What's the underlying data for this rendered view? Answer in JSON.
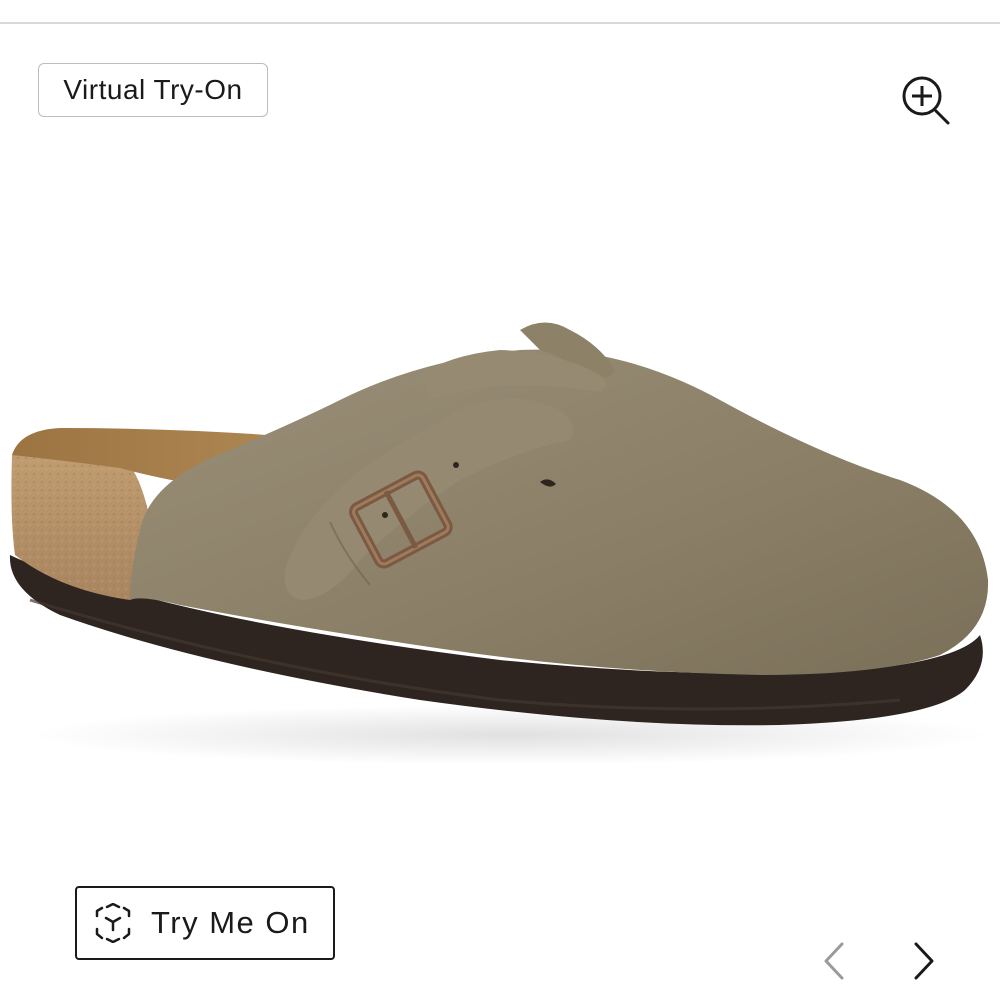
{
  "viewer": {
    "virtual_tryon_label": "Virtual Try-On",
    "try_me_on_label": "Try Me On",
    "zoom_icon": "zoom-in-icon",
    "prev_icon": "chevron-left-icon",
    "next_icon": "chevron-right-icon",
    "ar_icon": "ar-cube-icon"
  },
  "product_image": {
    "alt": "Taupe suede clog with buckle strap",
    "colors": {
      "suede": "#8c8068",
      "cork": "#b5936a",
      "footbed": "#a57f4c",
      "sole": "#2e2520",
      "buckle": "#7a5a42"
    }
  },
  "theme": {
    "prev_arrow_color": "#9a9a9a",
    "next_arrow_color": "#1a1a1a",
    "text_color": "#1a1a1a"
  }
}
